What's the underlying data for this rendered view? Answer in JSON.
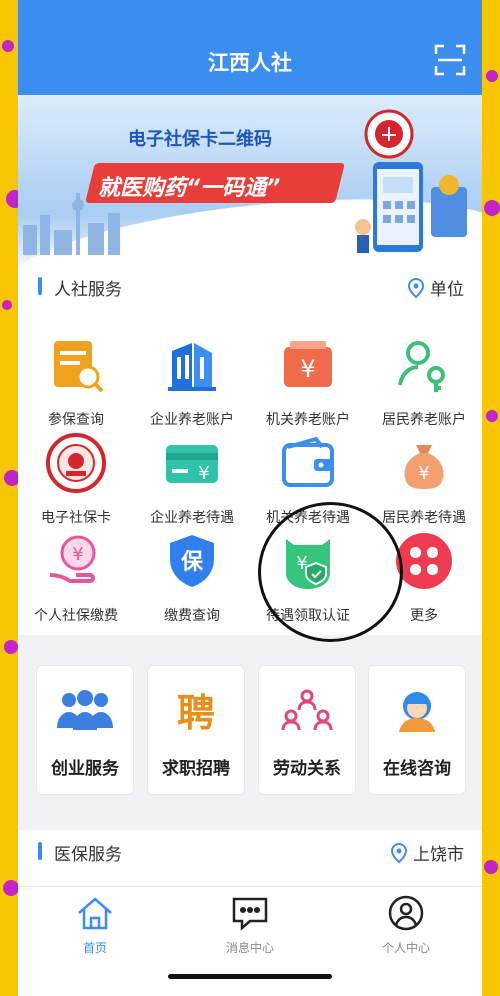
{
  "app": {
    "title": "江西人社"
  },
  "banner": {
    "line1": "电子社保卡二维码",
    "line2": "就医购药“一码通”"
  },
  "section1": {
    "title": "人社服务",
    "location": "单位",
    "items": [
      {
        "label": "参保查询",
        "icon": "document-search-icon"
      },
      {
        "label": "企业养老账户",
        "icon": "building-icon"
      },
      {
        "label": "机关养老账户",
        "icon": "yen-box-icon"
      },
      {
        "label": "居民养老账户",
        "icon": "person-key-icon"
      },
      {
        "label": "电子社保卡",
        "icon": "social-security-card-icon"
      },
      {
        "label": "企业养老待遇",
        "icon": "yen-card-icon"
      },
      {
        "label": "机关养老待遇",
        "icon": "wallet-icon"
      },
      {
        "label": "居民养老待遇",
        "icon": "money-bag-icon"
      },
      {
        "label": "个人社保缴费",
        "icon": "yen-hand-icon"
      },
      {
        "label": "缴费查询",
        "icon": "shield-bao-icon"
      },
      {
        "label": "待遇领取认证",
        "icon": "face-shield-yen-icon"
      },
      {
        "label": "更多",
        "icon": "more-grid-icon"
      }
    ]
  },
  "cards": [
    {
      "label": "创业服务",
      "icon": "team-icon"
    },
    {
      "label": "求职招聘",
      "icon": "recruit-icon"
    },
    {
      "label": "劳动关系",
      "icon": "people-network-icon"
    },
    {
      "label": "在线咨询",
      "icon": "consultant-icon"
    }
  ],
  "section2": {
    "title": "医保服务",
    "location": "上饶市"
  },
  "tabbar": [
    {
      "label": "首页",
      "icon": "home-icon",
      "active": true
    },
    {
      "label": "消息中心",
      "icon": "message-icon",
      "active": false
    },
    {
      "label": "个人中心",
      "icon": "user-icon",
      "active": false
    }
  ],
  "colors": {
    "primary": "#3a8ef0",
    "frame": "#f7c600"
  }
}
